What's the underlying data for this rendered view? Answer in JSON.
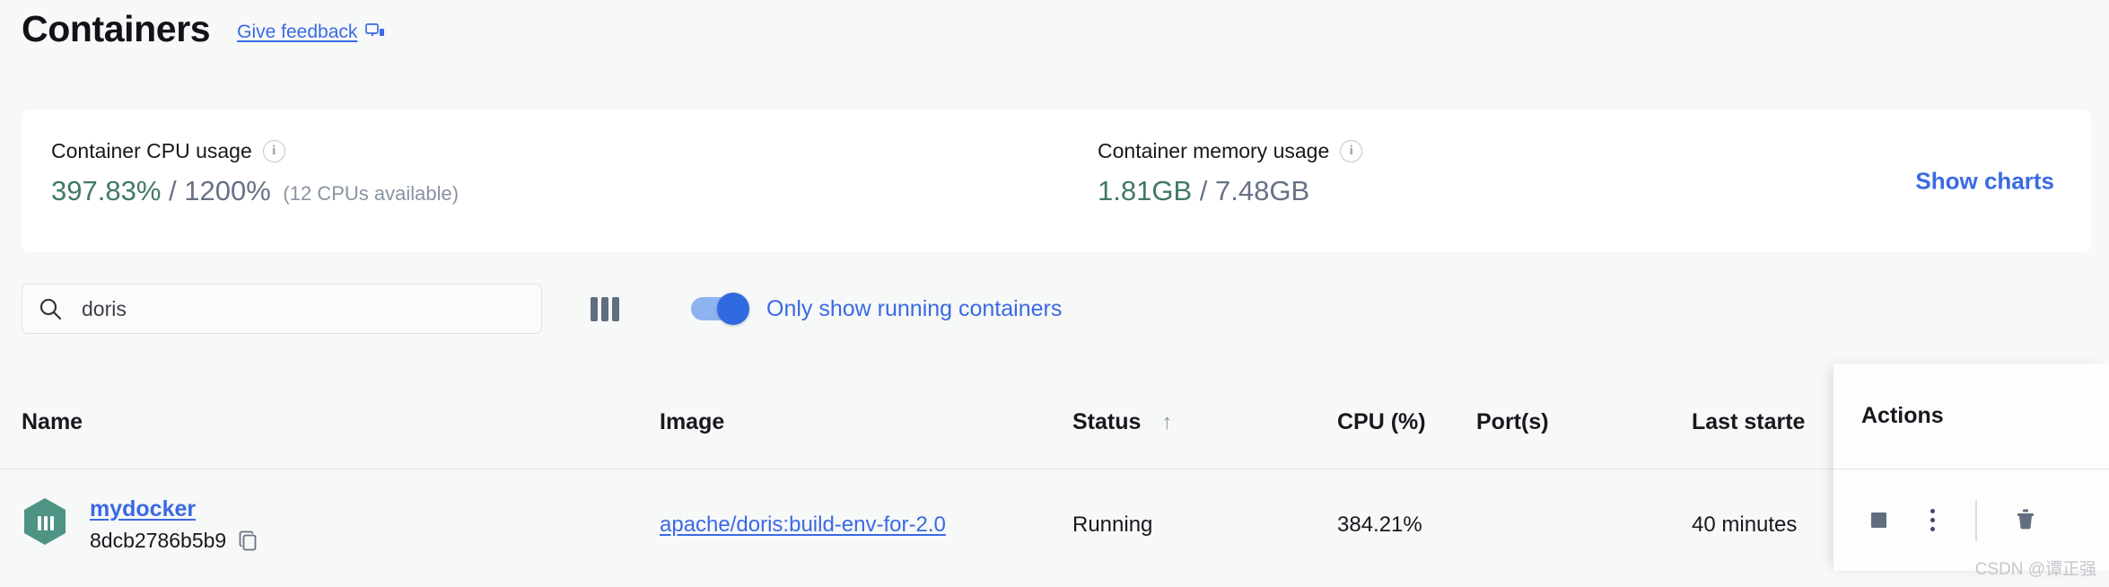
{
  "header": {
    "title": "Containers",
    "feedback_label": "Give feedback",
    "feedback_icon": "feedback-comment-icon"
  },
  "stats": {
    "cpu": {
      "label": "Container CPU usage",
      "info_icon": "info-icon",
      "used": "397.83%",
      "separator": "/",
      "total": "1200%",
      "note": "(12 CPUs available)"
    },
    "memory": {
      "label": "Container memory usage",
      "info_icon": "info-icon",
      "used": "1.81GB",
      "separator": "/",
      "total": "7.48GB",
      "note": ""
    },
    "show_charts_label": "Show charts",
    "used_color": "#41796b",
    "total_color": "#677285",
    "link_color": "#3a6ae4"
  },
  "toolbar": {
    "search_icon": "search-icon",
    "search_value": "doris",
    "search_placeholder": "Search",
    "columns_icon": "columns-layout-icon",
    "toggle": {
      "label": "Only show running containers",
      "state": "on"
    }
  },
  "table": {
    "columns": [
      {
        "key": "name",
        "label": "Name"
      },
      {
        "key": "image",
        "label": "Image"
      },
      {
        "key": "status",
        "label": "Status",
        "sort_icon": "sort-ascending-arrow"
      },
      {
        "key": "cpu",
        "label": "CPU (%)"
      },
      {
        "key": "ports",
        "label": "Port(s)"
      },
      {
        "key": "started",
        "label": "Last starte"
      }
    ],
    "rows": [
      {
        "icon": "container-cube-icon",
        "name": "mydocker",
        "id": "8dcb2786b5b9",
        "copy_icon": "copy-icon",
        "image": "apache/doris:build-env-for-2.0",
        "status": "Running",
        "cpu": "384.21%",
        "ports": "",
        "started": "40 minutes"
      }
    ]
  },
  "actions_panel": {
    "title": "Actions",
    "buttons": [
      {
        "name": "stop-button",
        "icon": "stop-square-icon"
      },
      {
        "name": "more-options-button",
        "icon": "kebab-vertical-icon"
      },
      {
        "name": "delete-button",
        "icon": "trash-icon"
      }
    ]
  },
  "watermark": "CSDN @谭正强"
}
